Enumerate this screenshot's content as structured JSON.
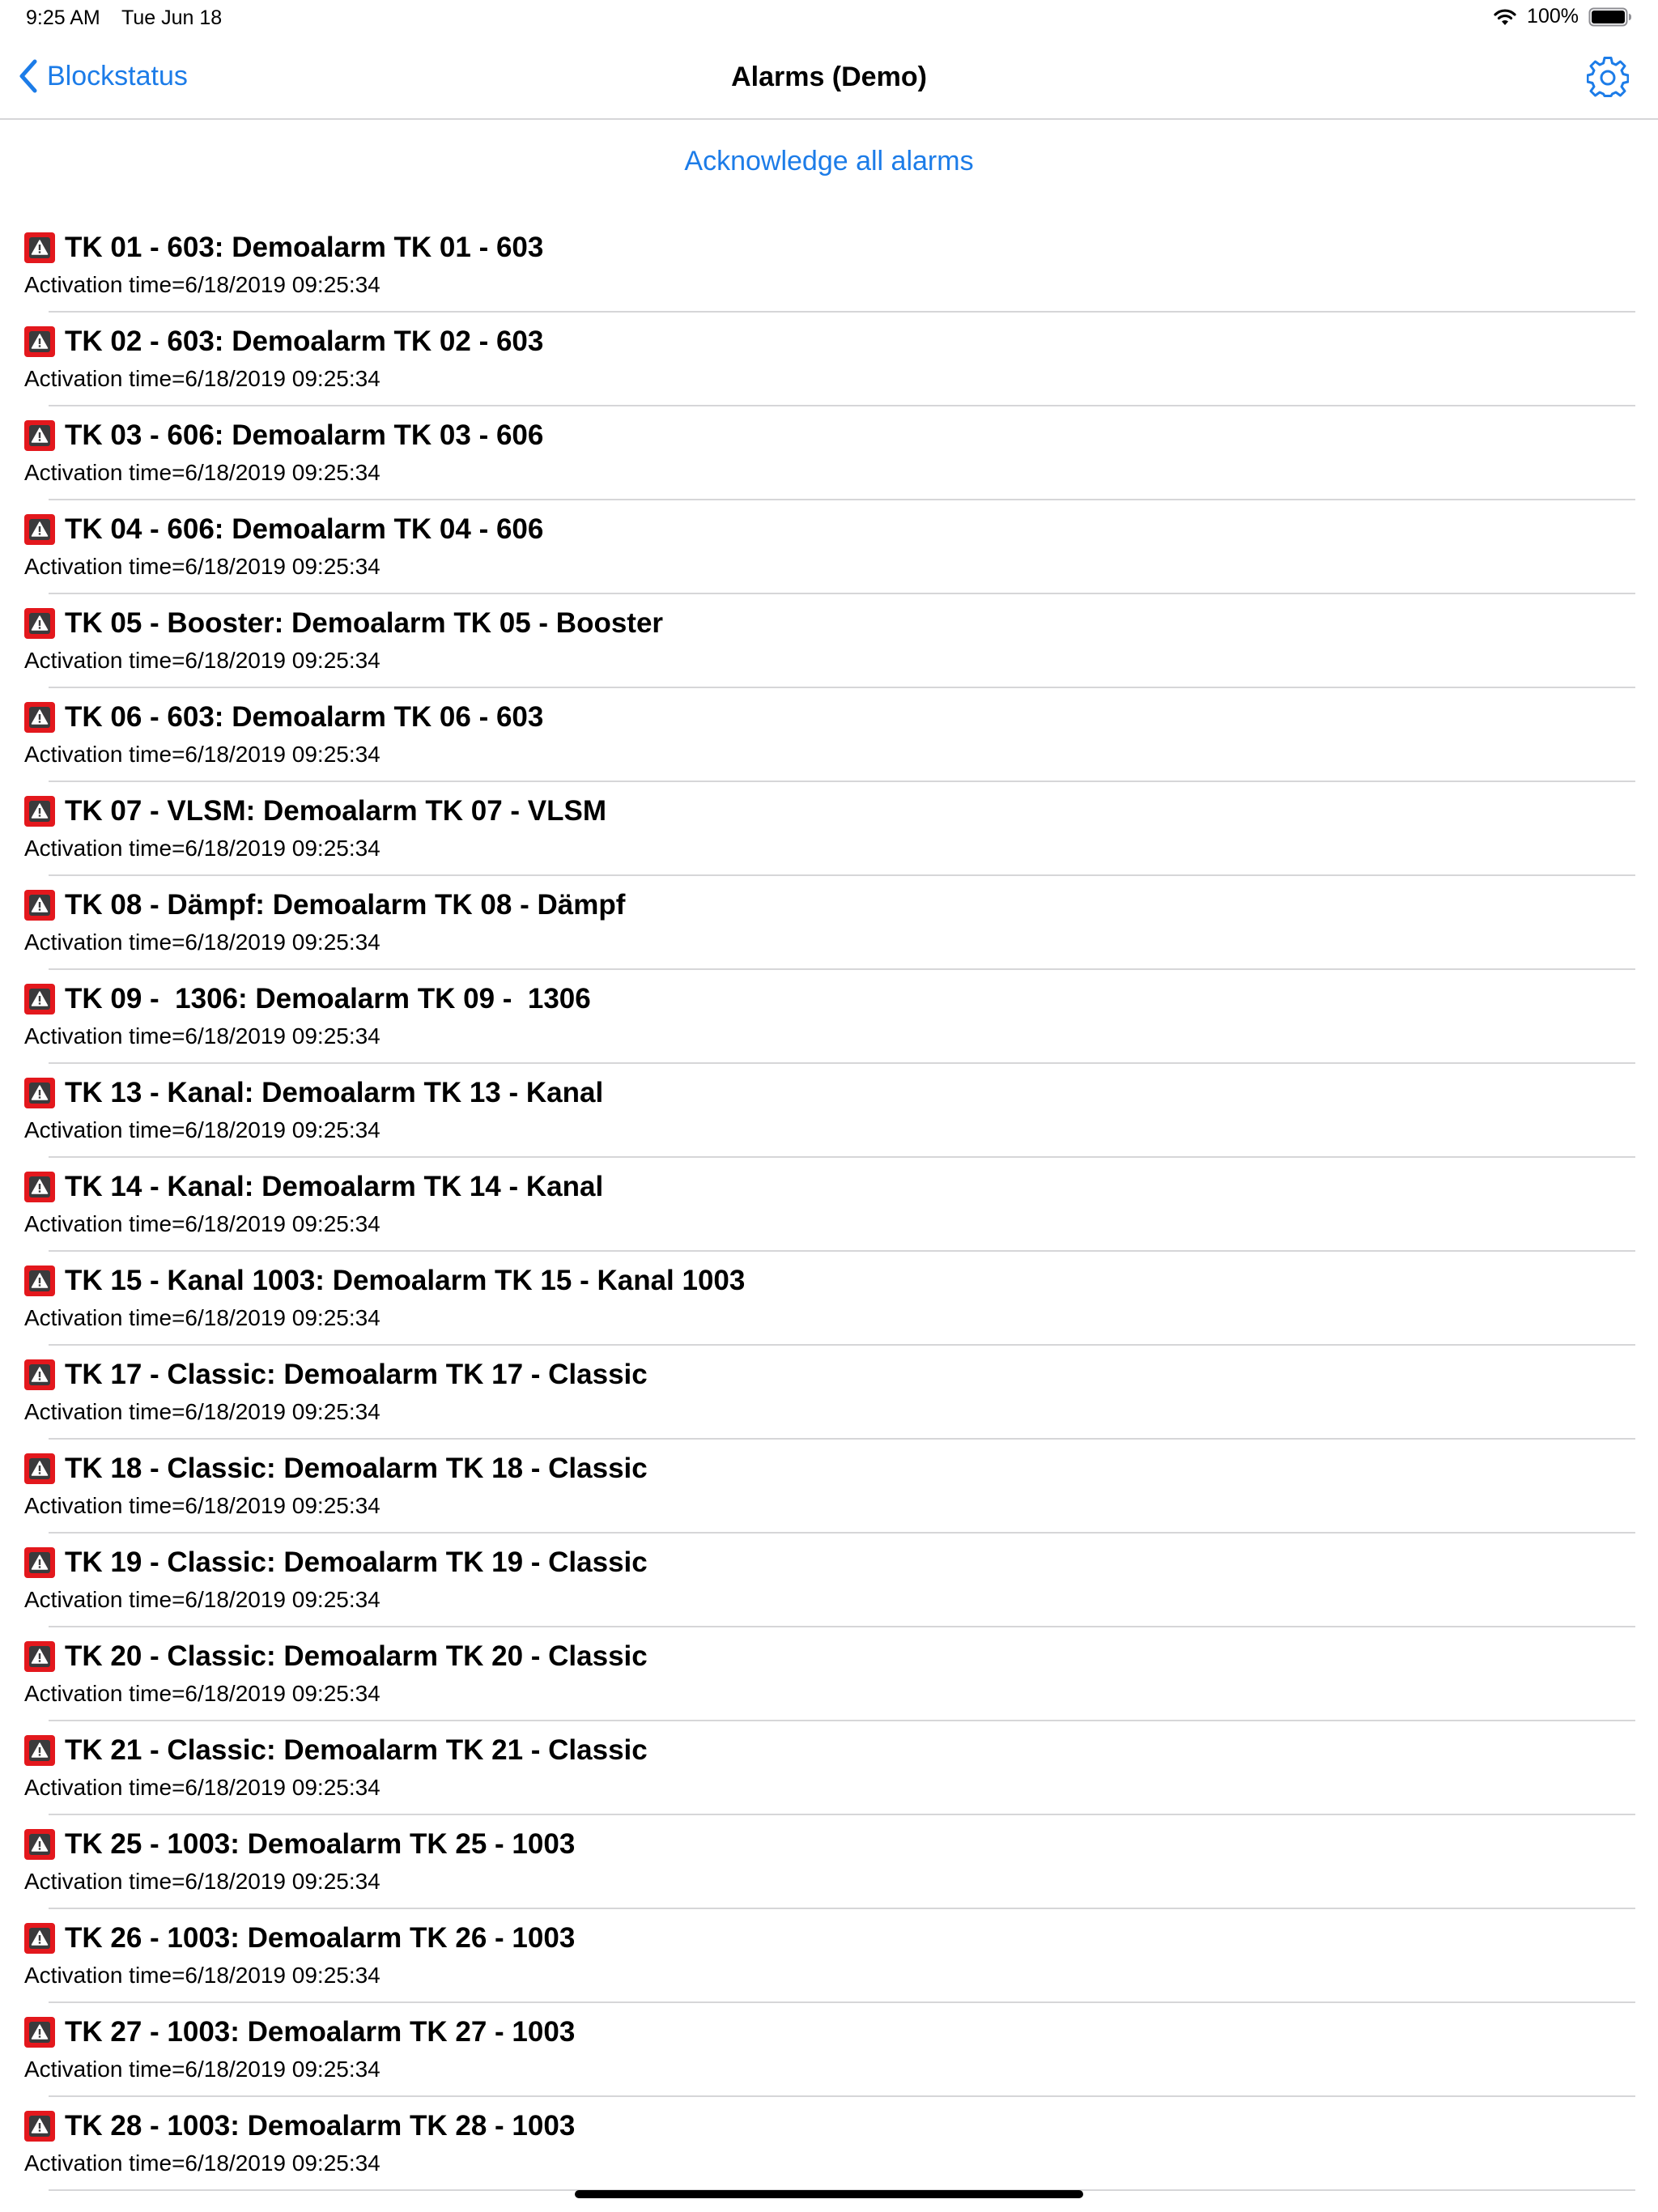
{
  "status_bar": {
    "time": "9:25 AM",
    "date": "Tue Jun 18",
    "battery_percent": "100%",
    "battery_level": 1.0
  },
  "nav": {
    "back_label": "Blockstatus",
    "title": "Alarms (Demo)",
    "accent_color": "#1c7ce8"
  },
  "ack_all_label": "Acknowledge all alarms",
  "alarm_icon_color": "#e3181d",
  "alarms": [
    {
      "title": "TK 01 - 603: Demoalarm TK 01 - 603",
      "time": "Activation time=6/18/2019 09:25:34"
    },
    {
      "title": "TK 02 - 603: Demoalarm TK 02 - 603",
      "time": "Activation time=6/18/2019 09:25:34"
    },
    {
      "title": "TK 03 - 606: Demoalarm TK 03 - 606",
      "time": "Activation time=6/18/2019 09:25:34"
    },
    {
      "title": "TK 04 - 606: Demoalarm TK 04 - 606",
      "time": "Activation time=6/18/2019 09:25:34"
    },
    {
      "title": "TK 05 - Booster: Demoalarm TK 05 - Booster",
      "time": "Activation time=6/18/2019 09:25:34"
    },
    {
      "title": "TK 06 - 603: Demoalarm TK 06 - 603",
      "time": "Activation time=6/18/2019 09:25:34"
    },
    {
      "title": "TK 07 - VLSM: Demoalarm TK 07 - VLSM",
      "time": "Activation time=6/18/2019 09:25:34"
    },
    {
      "title": "TK 08 - Dämpf: Demoalarm TK 08 - Dämpf",
      "time": "Activation time=6/18/2019 09:25:34"
    },
    {
      "title": "TK 09 -  1306: Demoalarm TK 09 -  1306",
      "time": "Activation time=6/18/2019 09:25:34"
    },
    {
      "title": "TK 13 - Kanal: Demoalarm TK 13 - Kanal",
      "time": "Activation time=6/18/2019 09:25:34"
    },
    {
      "title": "TK 14 - Kanal: Demoalarm TK 14 - Kanal",
      "time": "Activation time=6/18/2019 09:25:34"
    },
    {
      "title": "TK 15 - Kanal 1003: Demoalarm TK 15 - Kanal 1003",
      "time": "Activation time=6/18/2019 09:25:34"
    },
    {
      "title": "TK 17 - Classic: Demoalarm TK 17 - Classic",
      "time": "Activation time=6/18/2019 09:25:34"
    },
    {
      "title": "TK 18 - Classic: Demoalarm TK 18 - Classic",
      "time": "Activation time=6/18/2019 09:25:34"
    },
    {
      "title": "TK 19 - Classic: Demoalarm TK 19 - Classic",
      "time": "Activation time=6/18/2019 09:25:34"
    },
    {
      "title": "TK 20 - Classic: Demoalarm TK 20 - Classic",
      "time": "Activation time=6/18/2019 09:25:34"
    },
    {
      "title": "TK 21 - Classic: Demoalarm TK 21 - Classic",
      "time": "Activation time=6/18/2019 09:25:34"
    },
    {
      "title": "TK 25 - 1003: Demoalarm TK 25 - 1003",
      "time": "Activation time=6/18/2019 09:25:34"
    },
    {
      "title": "TK 26 - 1003: Demoalarm TK 26 - 1003",
      "time": "Activation time=6/18/2019 09:25:34"
    },
    {
      "title": "TK 27 - 1003: Demoalarm TK 27 - 1003",
      "time": "Activation time=6/18/2019 09:25:34"
    },
    {
      "title": "TK 28 - 1003: Demoalarm TK 28 - 1003",
      "time": "Activation time=6/18/2019 09:25:34"
    }
  ]
}
